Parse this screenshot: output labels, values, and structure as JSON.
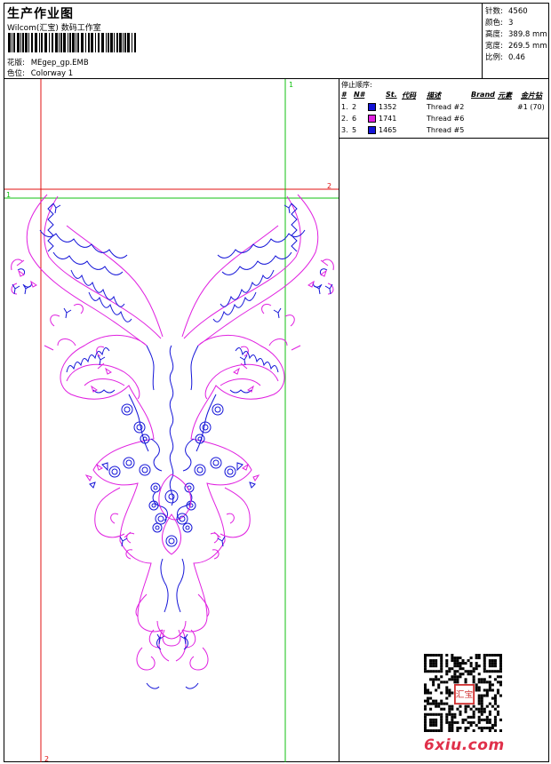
{
  "header": {
    "title": "生产作业图",
    "subtitle": "Wilcom(汇宝) 数码工作室",
    "design_label": "花版:",
    "design_value": "MEgep_gp.EMB",
    "colorway_label": "色位:",
    "colorway_value": "Colorway 1"
  },
  "stats": [
    {
      "label": "针数:",
      "value": "4560"
    },
    {
      "label": "颜色:",
      "value": "3"
    },
    {
      "label": "高度:",
      "value": "389.8 mm"
    },
    {
      "label": "宽度:",
      "value": "269.5 mm"
    },
    {
      "label": "比例:",
      "value": "0.46"
    }
  ],
  "stop_sequence": {
    "title": "停止顺序:",
    "columns": [
      "#",
      "N#",
      "St.",
      "代码",
      "描述",
      "Brand",
      "元素",
      "金片钻"
    ],
    "rows": [
      {
        "num": "1.",
        "n": "2",
        "color": "#1414d8",
        "code": "1352",
        "desc": "Thread #2",
        "extra": "#1 (70)"
      },
      {
        "num": "2.",
        "n": "6",
        "color": "#e020e0",
        "code": "1741",
        "desc": "Thread #6",
        "extra": ""
      },
      {
        "num": "3.",
        "n": "5",
        "color": "#1414d8",
        "code": "1465",
        "desc": "Thread #5",
        "extra": ""
      }
    ]
  },
  "guides": {
    "green_1": "1",
    "red_2": "2",
    "red_2b": "2",
    "green_1b": "1"
  },
  "watermark": {
    "text": "6xiu.com",
    "seal": "汇宝"
  },
  "colors": {
    "blue_thread": "#1414d8",
    "pink_thread": "#e020e0",
    "red_guide": "#e01010",
    "green_guide": "#10c010"
  }
}
